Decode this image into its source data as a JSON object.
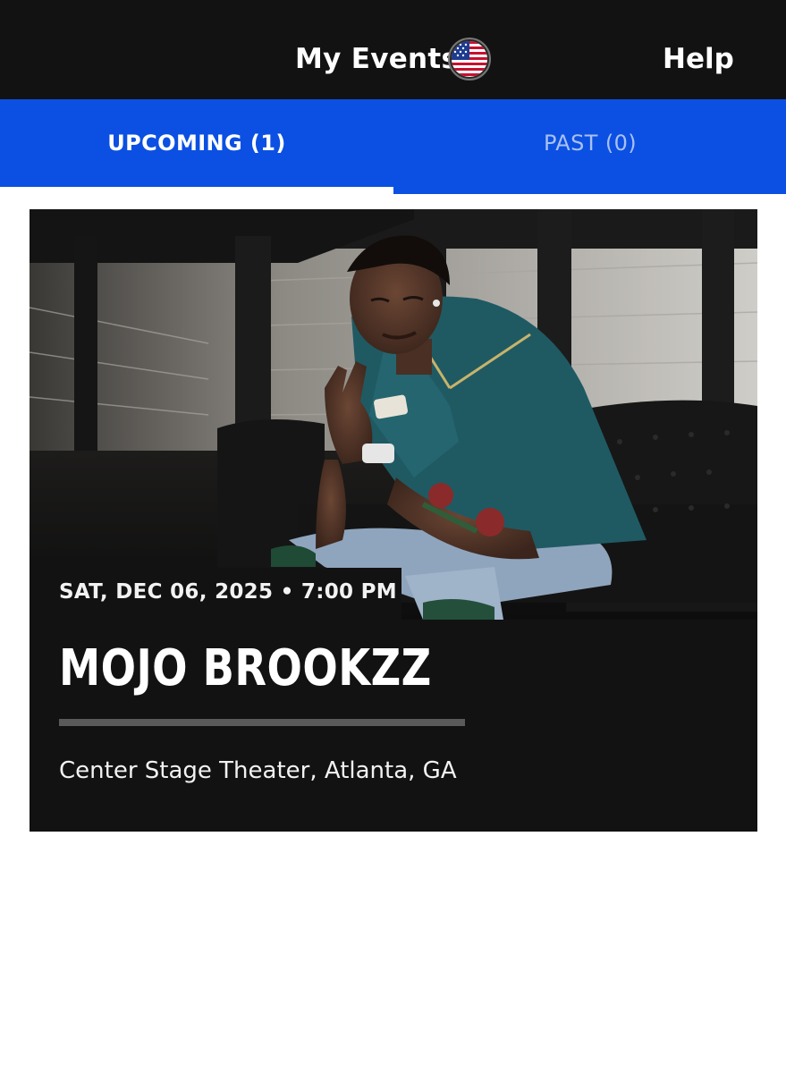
{
  "header": {
    "title": "My Events",
    "region_flag_icon": "us-flag-icon",
    "help_label": "Help",
    "background_color": "#121212"
  },
  "tabs": [
    {
      "label": "UPCOMING (1)",
      "active": true
    },
    {
      "label": "PAST (0)",
      "active": false
    }
  ],
  "accent_color": "#0b50e2",
  "events": [
    {
      "datetime": "SAT, DEC 06, 2025 • 7:00 PM",
      "artist": "MOJO BROOKZZ",
      "venue": "Center Stage Theater, Atlanta, GA",
      "image_alt": "Artist photo"
    }
  ]
}
